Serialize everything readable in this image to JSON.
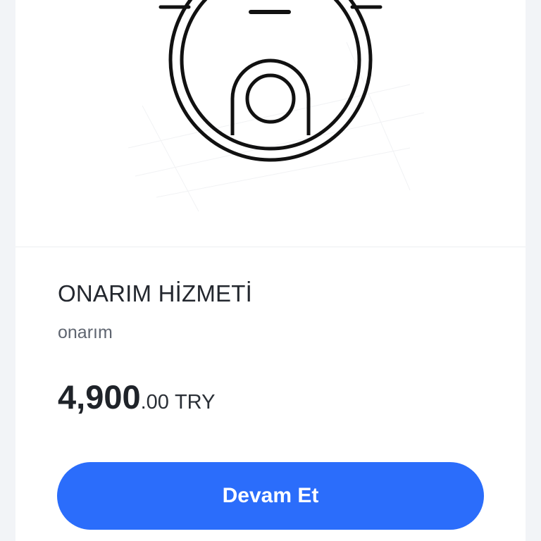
{
  "product": {
    "icon": "robot-vacuum-icon",
    "title": "ONARIM HİZMETİ",
    "category": "onarım",
    "price": {
      "integer_part": "4,900",
      "decimal_part": ".00",
      "currency": "TRY"
    }
  },
  "actions": {
    "continue_label": "Devam Et"
  },
  "colors": {
    "primary_button": "#2b6dfb",
    "page_background": "#f2f4f7",
    "card_background": "#ffffff"
  }
}
